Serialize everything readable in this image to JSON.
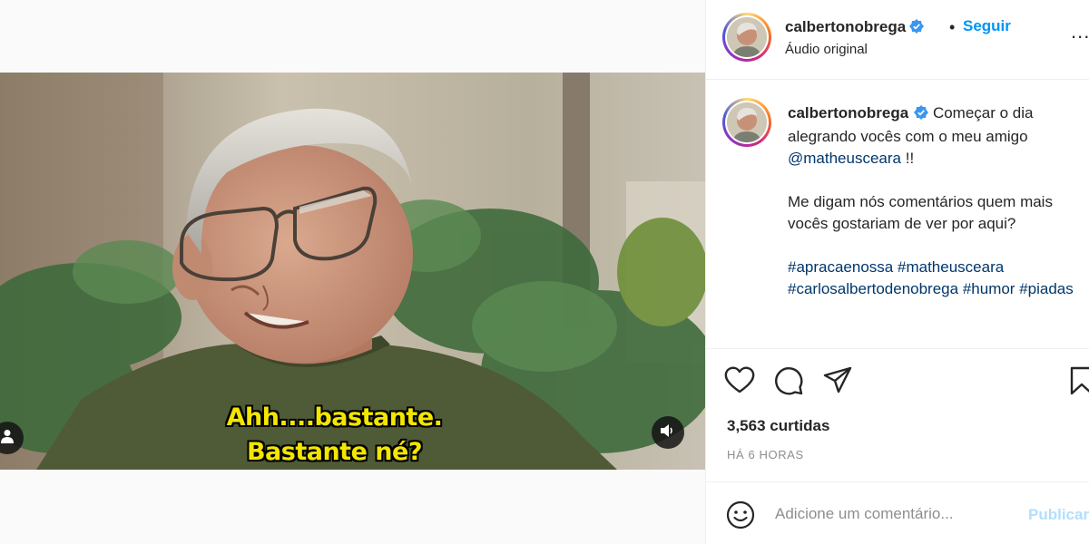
{
  "post": {
    "username": "calbertonobrega",
    "follow_label": "Seguir",
    "separator": "•",
    "audio_label": "Áudio original",
    "more_label": "...",
    "caption": {
      "line1": "Começar o dia alegrando vocês com o meu amigo",
      "mention": "@matheusceara",
      "after_mention": " !!",
      "paragraph2": "Me digam nós comentários quem mais vocês gostariam de ver por aqui?",
      "hashtags": [
        "#apracaenossa",
        "#matheusceara",
        "#carlosalbertodenobrega",
        "#humor",
        "#piadas"
      ]
    },
    "likes": "3,563 curtidas",
    "time_ago": "HÁ 6 HORAS",
    "comment_placeholder": "Adicione um comentário...",
    "publish_label": "Publicar"
  },
  "video": {
    "subtitle_line1": "Ahh....bastante.",
    "subtitle_line2": "Bastante né?"
  },
  "icons": {
    "verified": "verified-badge-icon",
    "like": "heart-icon",
    "comment": "comment-bubble-icon",
    "share": "paper-plane-icon",
    "save": "bookmark-icon",
    "emoji": "smiley-icon",
    "user_tags": "person-icon",
    "mute": "speaker-icon"
  },
  "colors": {
    "accent": "#0095f6",
    "publish_disabled": "#b2dffc",
    "link": "#00376b",
    "subtitle": "#f3e600"
  }
}
